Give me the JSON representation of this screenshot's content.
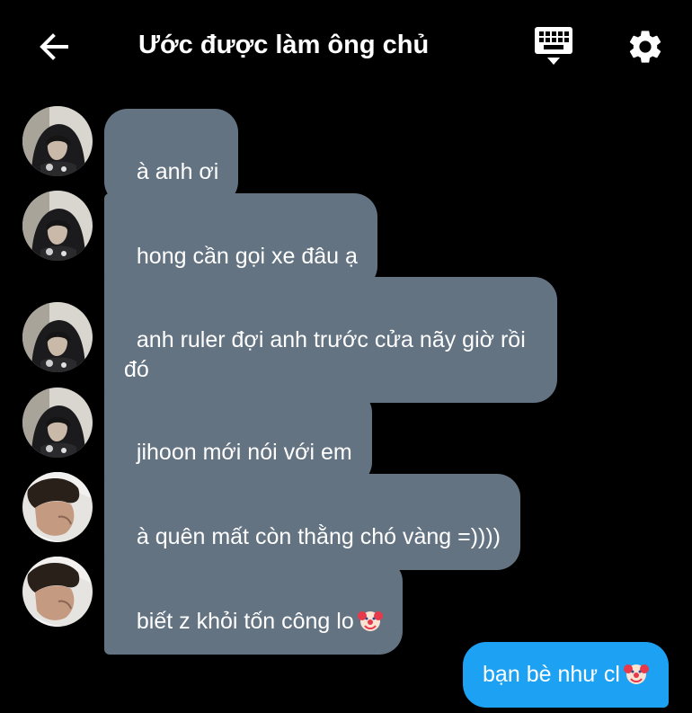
{
  "header": {
    "back_icon": "arrow-left-icon",
    "title": "Ước được làm ông chủ",
    "keyboard_icon": "keyboard-icon",
    "settings_icon": "gear-icon"
  },
  "colors": {
    "background": "#000000",
    "incoming_bubble": "#637382",
    "outgoing_bubble": "#1da1f2",
    "text": "#ffffff"
  },
  "messages": [
    {
      "direction": "incoming",
      "sender_avatar": "avatar-hooded",
      "text": "à anh ơi"
    },
    {
      "direction": "incoming",
      "sender_avatar": "avatar-hooded",
      "text": "hong cần gọi xe đâu ạ"
    },
    {
      "direction": "incoming",
      "sender_avatar": "avatar-hooded",
      "text": "anh ruler đợi anh trước cửa nãy giờ rồi\nđó"
    },
    {
      "direction": "incoming",
      "sender_avatar": "avatar-hooded",
      "text": "jihoon mới nói với em"
    },
    {
      "direction": "incoming",
      "sender_avatar": "avatar-boy",
      "text": "à quên mất còn thằng chó vàng =))))"
    },
    {
      "direction": "incoming",
      "sender_avatar": "avatar-boy",
      "text": "biết z khỏi tốn công lo",
      "emoji": "clown-emoji-icon"
    },
    {
      "direction": "outgoing",
      "text": "bạn bè như cl",
      "emoji": "clown-emoji-icon"
    }
  ]
}
